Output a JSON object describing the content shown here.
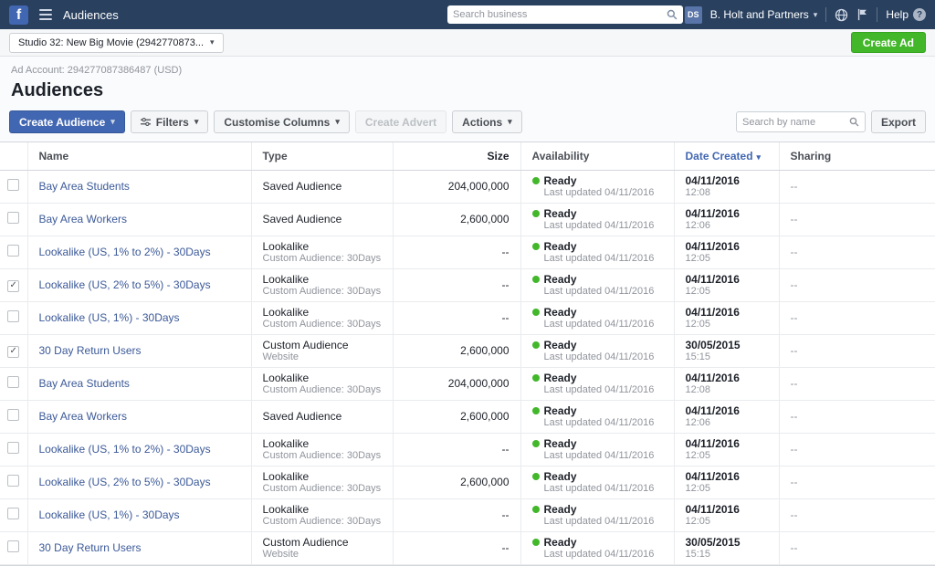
{
  "topbar": {
    "title": "Audiences",
    "search_placeholder": "Search business",
    "avatar_initials": "DS",
    "account_name": "B. Holt and Partners",
    "help_label": "Help"
  },
  "subbar": {
    "campaign_selector": "Studio 32: New Big Movie (2942770873...",
    "create_ad_label": "Create Ad"
  },
  "page": {
    "ad_account": "Ad Account: 294277087386487 (USD)",
    "title": "Audiences"
  },
  "toolbar": {
    "create_audience_label": "Create Audience",
    "filters_label": "Filters",
    "customise_columns_label": "Customise Columns",
    "create_advert_label": "Create Advert",
    "actions_label": "Actions",
    "search_placeholder": "Search by name",
    "export_label": "Export"
  },
  "table": {
    "sort_column": "date_created",
    "headers": {
      "name": "Name",
      "type": "Type",
      "size": "Size",
      "availability": "Availability",
      "date_created": "Date Created",
      "sharing": "Sharing"
    },
    "rows": [
      {
        "checked": false,
        "name": "Bay Area Students",
        "type": "Saved Audience",
        "type_sub": "",
        "size": "204,000,000",
        "availability": "Ready",
        "availability_sub": "Last updated 04/11/2016",
        "date": "04/11/2016",
        "time": "12:08",
        "sharing": "--"
      },
      {
        "checked": false,
        "name": "Bay Area Workers",
        "type": "Saved Audience",
        "type_sub": "",
        "size": "2,600,000",
        "availability": "Ready",
        "availability_sub": "Last updated 04/11/2016",
        "date": "04/11/2016",
        "time": "12:06",
        "sharing": "--"
      },
      {
        "checked": false,
        "name": "Lookalike (US, 1% to 2%) - 30Days",
        "type": "Lookalike",
        "type_sub": "Custom Audience: 30Days",
        "size": "--",
        "availability": "Ready",
        "availability_sub": "Last updated 04/11/2016",
        "date": "04/11/2016",
        "time": "12:05",
        "sharing": "--"
      },
      {
        "checked": true,
        "name": "Lookalike (US, 2% to 5%) - 30Days",
        "type": "Lookalike",
        "type_sub": "Custom Audience: 30Days",
        "size": "--",
        "availability": "Ready",
        "availability_sub": "Last updated 04/11/2016",
        "date": "04/11/2016",
        "time": "12:05",
        "sharing": "--"
      },
      {
        "checked": false,
        "name": "Lookalike (US, 1%) - 30Days",
        "type": "Lookalike",
        "type_sub": "Custom Audience: 30Days",
        "size": "--",
        "availability": "Ready",
        "availability_sub": "Last updated 04/11/2016",
        "date": "04/11/2016",
        "time": "12:05",
        "sharing": "--"
      },
      {
        "checked": true,
        "name": "30 Day Return Users",
        "type": "Custom Audience",
        "type_sub": "Website",
        "size": "2,600,000",
        "availability": "Ready",
        "availability_sub": "Last updated 04/11/2016",
        "date": "30/05/2015",
        "time": "15:15",
        "sharing": "--"
      },
      {
        "checked": false,
        "name": "Bay Area Students",
        "type": "Lookalike",
        "type_sub": "Custom Audience: 30Days",
        "size": "204,000,000",
        "availability": "Ready",
        "availability_sub": "Last updated 04/11/2016",
        "date": "04/11/2016",
        "time": "12:08",
        "sharing": "--"
      },
      {
        "checked": false,
        "name": "Bay Area Workers",
        "type": "Saved Audience",
        "type_sub": "",
        "size": "2,600,000",
        "availability": "Ready",
        "availability_sub": "Last updated 04/11/2016",
        "date": "04/11/2016",
        "time": "12:06",
        "sharing": "--"
      },
      {
        "checked": false,
        "name": "Lookalike (US, 1% to 2%) - 30Days",
        "type": "Lookalike",
        "type_sub": "Custom Audience: 30Days",
        "size": "--",
        "availability": "Ready",
        "availability_sub": "Last updated 04/11/2016",
        "date": "04/11/2016",
        "time": "12:05",
        "sharing": "--"
      },
      {
        "checked": false,
        "name": "Lookalike (US, 2% to 5%) - 30Days",
        "type": "Lookalike",
        "type_sub": "Custom Audience: 30Days",
        "size": "2,600,000",
        "availability": "Ready",
        "availability_sub": "Last updated 04/11/2016",
        "date": "04/11/2016",
        "time": "12:05",
        "sharing": "--"
      },
      {
        "checked": false,
        "name": "Lookalike (US, 1%) - 30Days",
        "type": "Lookalike",
        "type_sub": "Custom Audience: 30Days",
        "size": "--",
        "availability": "Ready",
        "availability_sub": "Last updated 04/11/2016",
        "date": "04/11/2016",
        "time": "12:05",
        "sharing": "--"
      },
      {
        "checked": false,
        "name": "30 Day Return Users",
        "type": "Custom Audience",
        "type_sub": "Website",
        "size": "--",
        "availability": "Ready",
        "availability_sub": "Last updated 04/11/2016",
        "date": "30/05/2015",
        "time": "15:15",
        "sharing": "--"
      }
    ]
  },
  "colors": {
    "topbar_bg": "#29405f",
    "brand_blue": "#4267b2",
    "link_blue": "#3b5998",
    "action_green": "#42b72a",
    "ready_dot_green": "#42b72a"
  }
}
